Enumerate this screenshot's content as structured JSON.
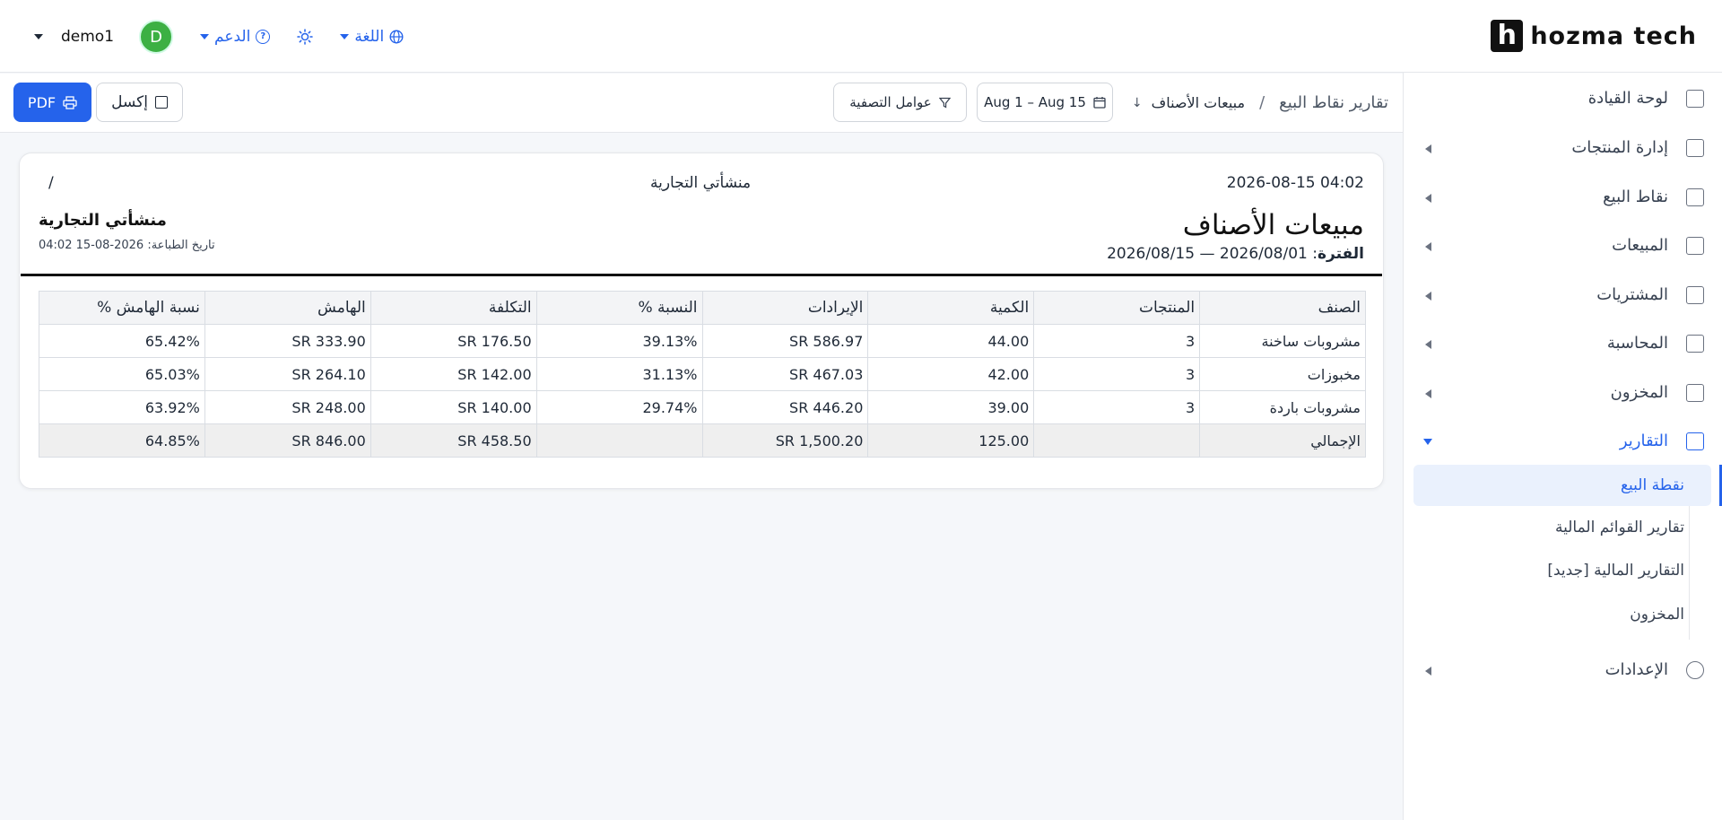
{
  "brand": {
    "logo_letter": "h",
    "name": "hozma tech"
  },
  "header": {
    "user_name": "demo1",
    "avatar_letter": "D",
    "support_label": "الدعم",
    "language_label": "اللغة"
  },
  "colors": {
    "accent": "#2563eb",
    "avatar": "#3cb043",
    "text": "#1f2937"
  },
  "sidebar": {
    "items": [
      {
        "label": "لوحة القيادة",
        "icon": "dashboard-icon"
      },
      {
        "label": "إدارة المنتجات",
        "icon": "tag-icon"
      },
      {
        "label": "نقاط البيع",
        "icon": "store-icon"
      },
      {
        "label": "المبيعات",
        "icon": "chart-line-icon"
      },
      {
        "label": "المشتريات",
        "icon": "wallet-icon"
      },
      {
        "label": "المحاسبة",
        "icon": "ledger-icon"
      },
      {
        "label": "المخزون",
        "icon": "box-icon"
      },
      {
        "label": "التقارير",
        "icon": "report-icon"
      },
      {
        "label": "الإعدادات",
        "icon": "gear-icon"
      }
    ],
    "report_sub": [
      {
        "label": "نقطة البيع"
      },
      {
        "label": "تقارير القوائم المالية"
      },
      {
        "label": "التقارير المالية [جديد]"
      },
      {
        "label": "المخزون"
      }
    ]
  },
  "toolbar": {
    "breadcrumb_root": "تقارير نقاط البيع",
    "breadcrumb_sep": "/",
    "breadcrumb_current": "مبيعات الأصناف",
    "date_range": "Aug 1 – Aug 15",
    "filters_label": "عوامل التصفية",
    "excel_label": "إكسل",
    "pdf_label": "PDF"
  },
  "report": {
    "timestamp": "2026-08-15 04:02",
    "center_company": "منشأتي التجارية",
    "slash": "/",
    "title": "مبيعات الأصناف",
    "period_label": "الفترة",
    "period_value": ": 2026/08/01 — 2026/08/15",
    "company": "منشأتي التجارية",
    "print_date": "تاريخ الطباعة: 2026-08-15 04:02",
    "columns": [
      "الصنف",
      "المنتجات",
      "الكمية",
      "الإيرادات",
      "النسبة %",
      "التكلفة",
      "الهامش",
      "نسبة الهامش %"
    ],
    "rows": [
      [
        "مشروبات ساخنة",
        "3",
        "44.00",
        "SR 586.97",
        "39.13%",
        "SR 176.50",
        "SR 333.90",
        "65.42%"
      ],
      [
        "مخبوزات",
        "3",
        "42.00",
        "SR 467.03",
        "31.13%",
        "SR 142.00",
        "SR 264.10",
        "65.03%"
      ],
      [
        "مشروبات باردة",
        "3",
        "39.00",
        "SR 446.20",
        "29.74%",
        "SR 140.00",
        "SR 248.00",
        "63.92%"
      ]
    ],
    "total": [
      "الإجمالي",
      "",
      "125.00",
      "SR 1,500.20",
      "",
      "SR 458.50",
      "SR 846.00",
      "64.85%"
    ]
  }
}
